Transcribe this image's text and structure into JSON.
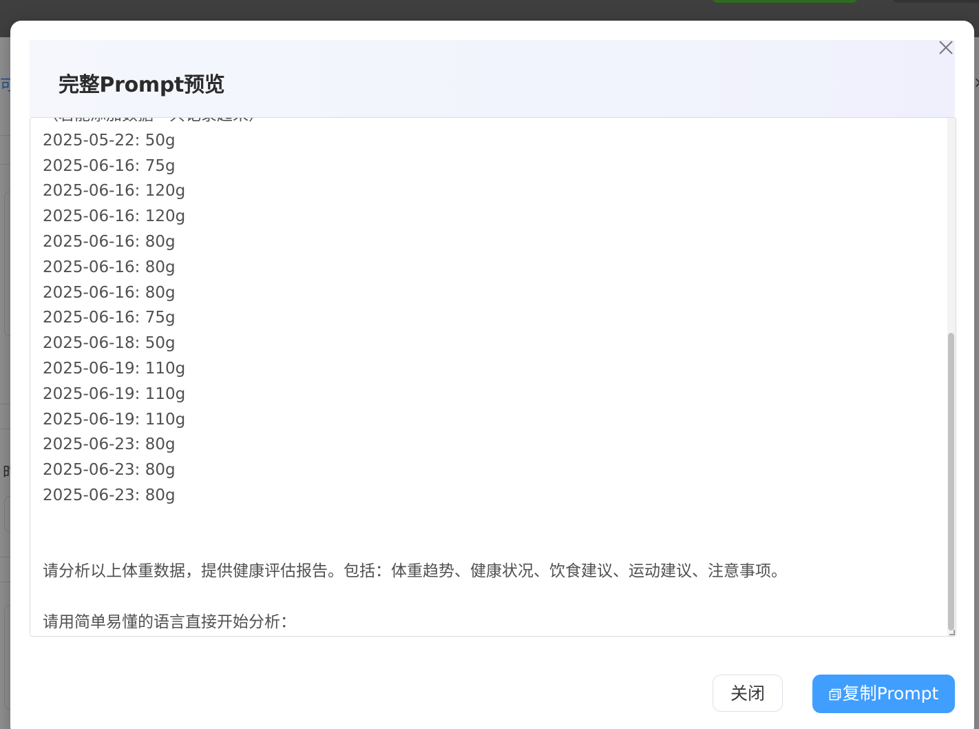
{
  "backdrop": {
    "partial_left_char": "时",
    "partial_blue_char": "可",
    "partial_right_x": "×"
  },
  "modal": {
    "title": "完整Prompt预览",
    "close_icon": "close-icon",
    "prompt_lines": [
      "（若能添加数据一共记录起来）",
      "2025-05-22: 50g",
      "2025-06-16: 75g",
      "2025-06-16: 120g",
      "2025-06-16: 120g",
      "2025-06-16: 80g",
      "2025-06-16: 80g",
      "2025-06-16: 80g",
      "2025-06-16: 75g",
      "2025-06-18: 50g",
      "2025-06-19: 110g",
      "2025-06-19: 110g",
      "2025-06-19: 110g",
      "2025-06-23: 80g",
      "2025-06-23: 80g",
      "2025-06-23: 80g",
      "",
      "",
      "请分析以上体重数据，提供健康评估报告。包括：体重趋势、健康状况、饮食建议、运动建议、注意事项。",
      "",
      "请用简单易懂的语言直接开始分析："
    ],
    "close_button_label": "关闭",
    "copy_button_label": "复制Prompt",
    "copy_icon": "copy-icon",
    "accent_color": "#409eff"
  }
}
